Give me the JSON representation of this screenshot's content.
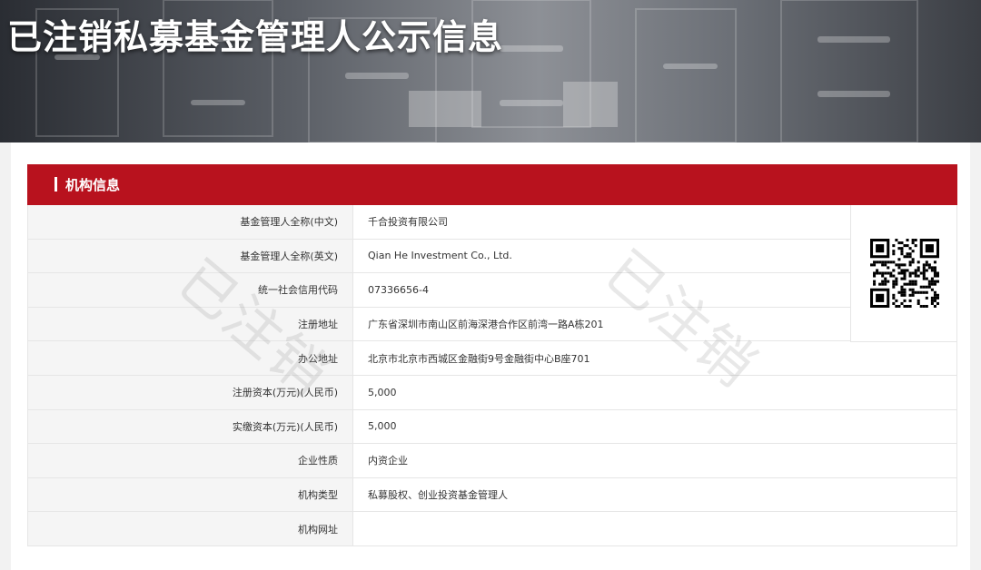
{
  "banner": {
    "title": "已注销私募基金管理人公示信息"
  },
  "section": {
    "title": "机构信息"
  },
  "watermark": {
    "text": "已注销"
  },
  "rows": [
    {
      "label": "基金管理人全称(中文)",
      "value": "千合投资有限公司"
    },
    {
      "label": "基金管理人全称(英文)",
      "value": "Qian He Investment Co., Ltd."
    },
    {
      "label": "统一社会信用代码",
      "value": "07336656-4"
    },
    {
      "label": "注册地址",
      "value": "广东省深圳市南山区前海深港合作区前湾一路A栋201"
    },
    {
      "label": "办公地址",
      "value": "北京市北京市西城区金融街9号金融街中心B座701"
    },
    {
      "label": "注册资本(万元)(人民币)",
      "value": "5,000"
    },
    {
      "label": "实缴资本(万元)(人民币)",
      "value": "5,000"
    },
    {
      "label": "企业性质",
      "value": "内资企业"
    },
    {
      "label": "机构类型",
      "value": "私募股权、创业投资基金管理人"
    },
    {
      "label": "机构网址",
      "value": ""
    }
  ],
  "colors": {
    "header_red": "#b8121e",
    "label_bg": "#f5f5f5",
    "border": "#e6e6e6",
    "text": "#333333"
  },
  "qr": {
    "icon": "qr-code-icon"
  }
}
